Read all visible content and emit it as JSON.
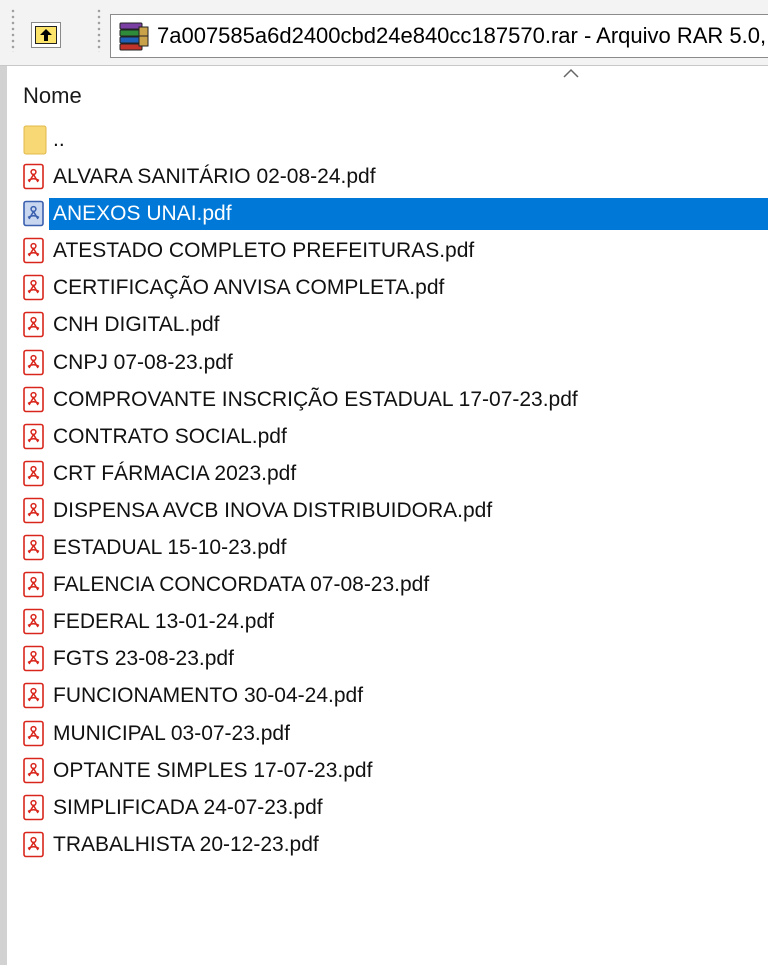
{
  "toolbar": {
    "up_button_icon": "up-folder-icon",
    "address": {
      "icon": "winrar-archive-icon",
      "text": "7a007585a6d2400cbd24e840cc187570.rar - Arquivo RAR 5.0,"
    }
  },
  "list": {
    "column_header": "Nome",
    "sort_icon": "sort-ascending-icon",
    "items": [
      {
        "label": "..",
        "type": "folder-up"
      },
      {
        "label": "ALVARA SANITÁRIO 02-08-24.pdf",
        "type": "pdf"
      },
      {
        "label": "ANEXOS UNAI.pdf",
        "type": "pdf",
        "selected": true
      },
      {
        "label": "ATESTADO COMPLETO PREFEITURAS.pdf",
        "type": "pdf"
      },
      {
        "label": "CERTIFICAÇÃO ANVISA COMPLETA.pdf",
        "type": "pdf"
      },
      {
        "label": "CNH DIGITAL.pdf",
        "type": "pdf"
      },
      {
        "label": "CNPJ 07-08-23.pdf",
        "type": "pdf"
      },
      {
        "label": "COMPROVANTE INSCRIÇÃO ESTADUAL 17-07-23.pdf",
        "type": "pdf"
      },
      {
        "label": "CONTRATO SOCIAL.pdf",
        "type": "pdf"
      },
      {
        "label": "CRT FÁRMACIA 2023.pdf",
        "type": "pdf"
      },
      {
        "label": "DISPENSA AVCB INOVA DISTRIBUIDORA.pdf",
        "type": "pdf"
      },
      {
        "label": "ESTADUAL 15-10-23.pdf",
        "type": "pdf"
      },
      {
        "label": "FALENCIA CONCORDATA 07-08-23.pdf",
        "type": "pdf"
      },
      {
        "label": "FEDERAL 13-01-24.pdf",
        "type": "pdf"
      },
      {
        "label": "FGTS 23-08-23.pdf",
        "type": "pdf"
      },
      {
        "label": "FUNCIONAMENTO 30-04-24.pdf",
        "type": "pdf"
      },
      {
        "label": "MUNICIPAL 03-07-23.pdf",
        "type": "pdf"
      },
      {
        "label": "OPTANTE SIMPLES 17-07-23.pdf",
        "type": "pdf"
      },
      {
        "label": "SIMPLIFICADA 24-07-23.pdf",
        "type": "pdf"
      },
      {
        "label": "TRABALHISTA 20-12-23.pdf",
        "type": "pdf"
      }
    ]
  },
  "colors": {
    "selection": "#0078d7",
    "pdf_red": "#d9261c",
    "folder_yellow": "#f8d775"
  }
}
